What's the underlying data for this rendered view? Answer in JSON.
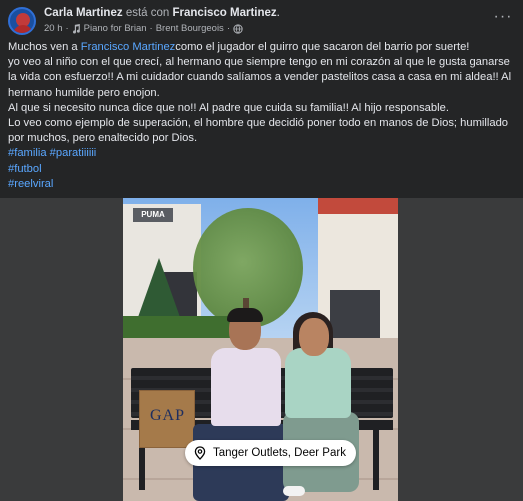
{
  "post": {
    "author": "Carla Martinez",
    "with_text": "está con",
    "tagged": "Francisco Martinez",
    "period": ".",
    "time": "20 h",
    "separator": "·",
    "music": "Piano for Brian",
    "music_artist": "Brent Bourgeois",
    "more_label": "···"
  },
  "body": {
    "line1_pre": "Muchos ven a ",
    "line1_mention": "Francisco Martinez",
    "line1_post": "como el jugador el guirro que sacaron del barrio por suerte!",
    "para2": " yo veo al niño con el que crecí, al hermano que siempre tengo en mi corazón al que le gusta ganarse la vida con esfuerzo!! A mi cuidador cuando salíamos a vender pastelitos casa a casa en mi aldea!! Al hermano humilde pero enojon.",
    "para3": "Al que si necesito nunca dice que no!! Al padre que cuida su familia!! Al hijo responsable.",
    "para4": "Lo veo como ejemplo de superación, el hombre que decidió poner todo en manos de Dios; humillado por muchos, pero enaltecido por Dios.",
    "hashtags": [
      "#familia #paratiiiiii",
      "#futbol",
      "#reelviral"
    ]
  },
  "photo": {
    "location": "Tanger Outlets, Deer Park",
    "store_sign": "PUMA",
    "bag_text": "GAP"
  },
  "colors": {
    "background": "#242526",
    "text": "#e4e6eb",
    "secondary": "#b0b3b8",
    "link": "#5aa7ff"
  }
}
